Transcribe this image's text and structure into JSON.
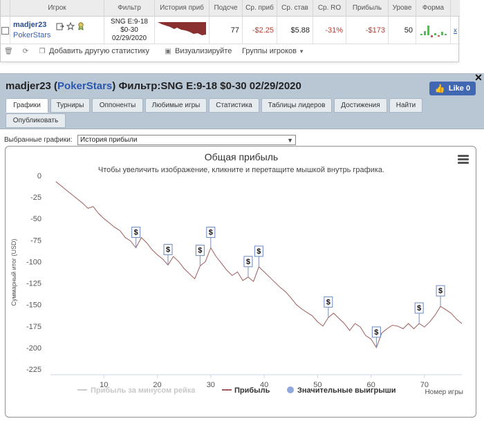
{
  "table": {
    "headers": [
      "Игрок",
      "Фильтр",
      "История приб",
      "Подсче",
      "Ср. приб",
      "Ср. став",
      "Ср. RO",
      "Прибыль",
      "Урове",
      "Форма"
    ],
    "row": {
      "player": "madjer23",
      "network": "PokerStars",
      "filter_line1": "SNG E:9-18",
      "filter_line2": "$0-30",
      "filter_line3": "02/29/2020",
      "count": "77",
      "avg_profit": "-$2.25",
      "avg_stake": "$5.88",
      "avg_roi": "-31%",
      "profit": "-$173",
      "level": "50",
      "remove": "x"
    },
    "toolbar": {
      "add_stat": "Добавить другую статистику",
      "visualize": "Визуализируйте",
      "groups": "Группы игроков"
    }
  },
  "panel": {
    "player": "madjer23",
    "network": "PokerStars",
    "title_tail": "Фильтр:SNG E:9-18 $0-30 02/29/2020",
    "like_label": "Like 0",
    "tabs": [
      "Графики",
      "Турниры",
      "Оппоненты",
      "Любимые игры",
      "Статистика",
      "Таблицы лидеров",
      "Достижения",
      "Найти",
      "Опубликовать"
    ],
    "active_tab": "Графики",
    "selected_charts_label": "Выбранные графики:",
    "selected_chart_value": "История прибыли"
  },
  "chart_data": {
    "type": "line",
    "title": "Общая прибыль",
    "subtitle": "Чтобы увеличить изображение, кликните и перетащите мышкой внутрь графика.",
    "ylabel": "Суммарный итог (USD)",
    "xlabel": "Номер игры",
    "ylim": [
      -225,
      0
    ],
    "yticks": [
      0,
      -25,
      -50,
      -75,
      -100,
      -125,
      -150,
      -175,
      -200,
      -225
    ],
    "xlim": [
      0,
      77
    ],
    "xticks": [
      10,
      20,
      30,
      40,
      50,
      60,
      70
    ],
    "legend": [
      "Прибыль за минусом рейка",
      "Прибыль",
      "Значительные выигрыши"
    ],
    "legend_position": "bottom",
    "colors": {
      "profit": "#a05a5a",
      "rake_free": "#cccccc",
      "big_wins": "#8fa8e0"
    },
    "series": [
      {
        "name": "Прибыль",
        "x": [
          1,
          2,
          3,
          4,
          5,
          6,
          7,
          8,
          9,
          10,
          11,
          12,
          13,
          14,
          15,
          16,
          17,
          18,
          19,
          20,
          21,
          22,
          23,
          24,
          25,
          26,
          27,
          28,
          29,
          30,
          31,
          32,
          33,
          34,
          35,
          36,
          37,
          38,
          39,
          40,
          41,
          42,
          43,
          44,
          45,
          46,
          47,
          48,
          49,
          50,
          51,
          52,
          53,
          54,
          55,
          56,
          57,
          58,
          59,
          60,
          61,
          62,
          63,
          64,
          65,
          66,
          67,
          68,
          69,
          70,
          71,
          72,
          73,
          74,
          75,
          76,
          77
        ],
        "y": [
          -7,
          -12,
          -17,
          -22,
          -27,
          -32,
          -38,
          -36,
          -44,
          -50,
          -55,
          -60,
          -64,
          -72,
          -76,
          -84,
          -72,
          -78,
          -86,
          -92,
          -97,
          -104,
          -94,
          -100,
          -108,
          -114,
          -120,
          -105,
          -100,
          -84,
          -94,
          -102,
          -110,
          -116,
          -112,
          -122,
          -118,
          -123,
          -106,
          -112,
          -118,
          -124,
          -130,
          -135,
          -142,
          -150,
          -155,
          -159,
          -163,
          -170,
          -175,
          -165,
          -160,
          -166,
          -172,
          -180,
          -172,
          -176,
          -186,
          -190,
          -200,
          -183,
          -178,
          -174,
          -175,
          -178,
          -172,
          -178,
          -172,
          -176,
          -170,
          -162,
          -152,
          -156,
          -160,
          -167,
          -172
        ]
      }
    ],
    "big_wins_markers": [
      16,
      22,
      28,
      30,
      37,
      39,
      52,
      61,
      69,
      73
    ]
  }
}
